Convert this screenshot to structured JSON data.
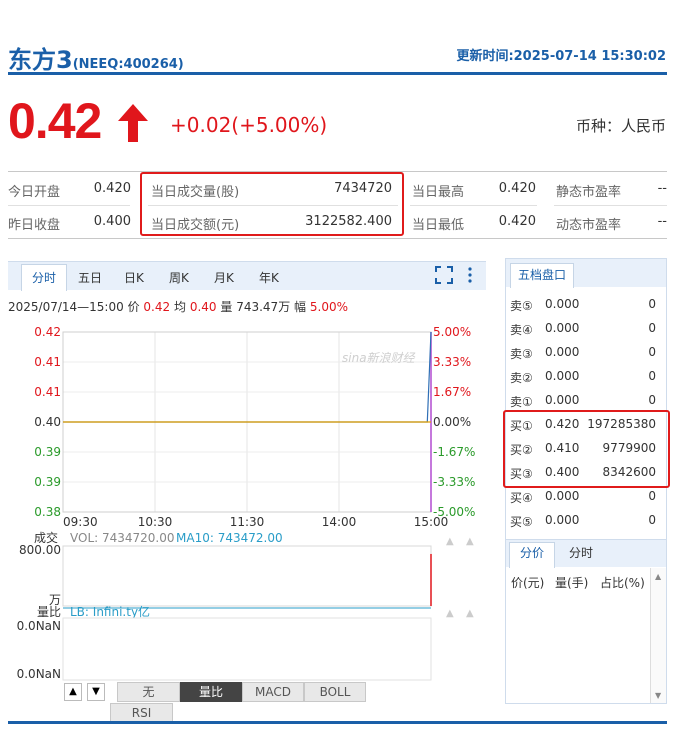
{
  "header": {
    "name": "东方3",
    "code": "(NEEQ:400264)",
    "update_label": "更新时间:",
    "update_time": "2025-07-14 15:30:02"
  },
  "quote": {
    "price": "0.42",
    "change": "+0.02(+5.00%)",
    "currency": "币种：人民币"
  },
  "stats": {
    "open_label": "今日开盘",
    "open": "0.420",
    "prev_close_label": "昨日收盘",
    "prev_close": "0.400",
    "volume_label": "当日成交量(股)",
    "volume": "7434720",
    "amount_label": "当日成交额(元)",
    "amount": "3122582.400",
    "high_label": "当日最高",
    "high": "0.420",
    "low_label": "当日最低",
    "low": "0.420",
    "static_pe_label": "静态市盈率",
    "static_pe": "--",
    "dynamic_pe_label": "动态市盈率",
    "dynamic_pe": "--"
  },
  "chart_tabs": [
    "分时",
    "五日",
    "日K",
    "周K",
    "月K",
    "年K"
  ],
  "chart_tab_active": "分时",
  "chart_info": {
    "date": "2025/07/14—15:00",
    "price_label": "价",
    "price": "0.42",
    "avg_label": "均",
    "avg": "0.40",
    "vol_label": "量",
    "vol": "743.47万",
    "amp_label": "幅",
    "amp": "5.00%"
  },
  "watermark": "sina新浪财经",
  "chart_data": [
    {
      "type": "line",
      "title": "",
      "x_ticks": [
        "09:30",
        "10:30",
        "11:30",
        "14:00",
        "15:00"
      ],
      "y_left_ticks": [
        "0.42",
        "0.41",
        "0.41",
        "0.40",
        "0.39",
        "0.39",
        "0.38"
      ],
      "y_right_ticks": [
        "5.00%",
        "3.33%",
        "1.67%",
        "0.00%",
        "-1.67%",
        "-3.33%",
        "-5.00%"
      ],
      "ylim": [
        0.38,
        0.42
      ],
      "prev_close": 0.4,
      "series": [
        {
          "name": "价",
          "color": "#2f6fb5",
          "points": [
            [
              0,
              0.4
            ],
            [
              0.99,
              0.4
            ],
            [
              1.0,
              0.42
            ]
          ]
        },
        {
          "name": "均",
          "color": "#e3a000",
          "points": [
            [
              0,
              0.4
            ],
            [
              1.0,
              0.4
            ]
          ]
        }
      ]
    },
    {
      "type": "bar",
      "title": "",
      "vol_label": "成交",
      "vol_text": "VOL: 7434720.00",
      "ma10_text": "MA10: 743472.00",
      "y_top": "800.00",
      "y_unit": "万",
      "ylim": [
        0,
        800
      ],
      "values": [
        {
          "x": 1.0,
          "value": 743.47
        }
      ]
    },
    {
      "type": "line",
      "title": "",
      "label": "量比",
      "lb_text": "LB: Infini.ty亿",
      "y_ticks": [
        "0.0NaN",
        "0.0NaN"
      ]
    }
  ],
  "tools": [
    "无",
    "量比",
    "MACD",
    "BOLL",
    "RSI"
  ],
  "tool_active": "量比",
  "order_book": {
    "tab": "五档盘口",
    "rows": [
      {
        "label": "卖⑤",
        "price": "0.000",
        "vol": "0"
      },
      {
        "label": "卖④",
        "price": "0.000",
        "vol": "0"
      },
      {
        "label": "卖③",
        "price": "0.000",
        "vol": "0"
      },
      {
        "label": "卖②",
        "price": "0.000",
        "vol": "0"
      },
      {
        "label": "卖①",
        "price": "0.000",
        "vol": "0"
      },
      {
        "label": "买①",
        "price": "0.420",
        "vol": "197285380"
      },
      {
        "label": "买②",
        "price": "0.410",
        "vol": "9779900"
      },
      {
        "label": "买③",
        "price": "0.400",
        "vol": "8342600"
      },
      {
        "label": "买④",
        "price": "0.000",
        "vol": "0"
      },
      {
        "label": "买⑤",
        "price": "0.000",
        "vol": "0"
      }
    ],
    "sub_tabs": [
      "分价",
      "分时"
    ],
    "columns": [
      "价(元)",
      "量(手)",
      "占比(%)"
    ]
  },
  "colors": {
    "brand": "#1a5fa8",
    "up": "#e0161c",
    "down": "#2a9a2a",
    "highlight": "#e01b1b"
  }
}
